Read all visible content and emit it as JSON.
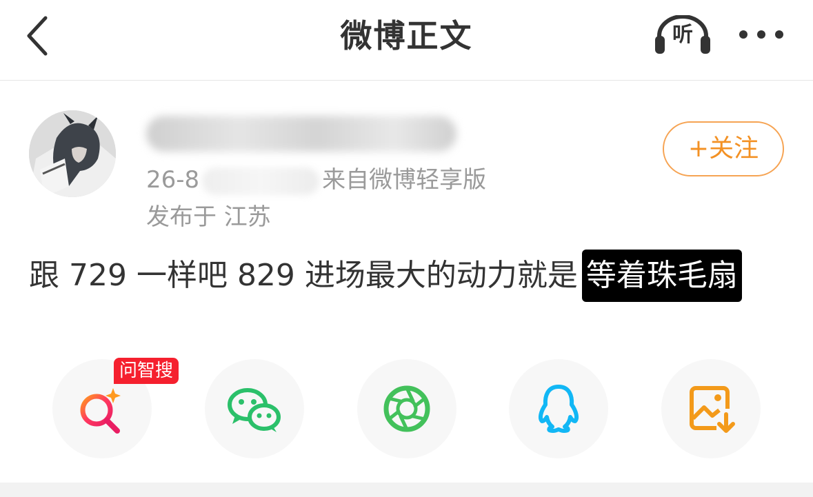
{
  "header": {
    "title": "微博正文",
    "listen_label": "听"
  },
  "post": {
    "username": "",
    "time_prefix": "26-8",
    "source": "来自微博轻享版",
    "location": "发布于 江苏",
    "follow_label": "+关注",
    "text": "跟 729 一样吧 829 进场最大的动力就是",
    "highlight": "等着珠毛扇"
  },
  "share": {
    "badge": "问智搜",
    "items": [
      "search-ai-icon",
      "wechat-icon",
      "moments-icon",
      "qq-icon",
      "save-image-icon"
    ]
  },
  "colors": {
    "follow": "#f39124",
    "badge": "#f5202e",
    "wechat": "#2bc06a",
    "qq": "#12b7f5",
    "save": "#f39a1a"
  }
}
